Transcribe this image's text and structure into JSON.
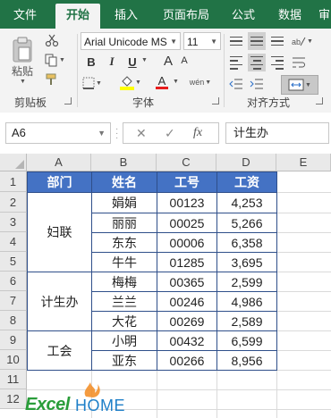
{
  "ribbon": {
    "tabs": [
      "文件",
      "开始",
      "插入",
      "页面布局",
      "公式",
      "数据",
      "审阅"
    ],
    "active_tab": "开始",
    "groups": {
      "clipboard_label": "剪贴板",
      "paste_label": "粘贴",
      "font_label": "字体",
      "alignment_label": "对齐方式"
    },
    "font_name": "Arial Unicode MS",
    "font_size": "11",
    "bold": "B",
    "italic": "I",
    "underline": "U",
    "grow_font": "A",
    "shrink_font": "A",
    "font_color": "A",
    "wen": "wén"
  },
  "formula_bar": {
    "name_box": "A6",
    "cancel": "✕",
    "enter": "✓",
    "fx": "fx",
    "content": "计生办"
  },
  "grid": {
    "column_headers": [
      "A",
      "B",
      "C",
      "D",
      "E"
    ],
    "row_headers": [
      "1",
      "2",
      "3",
      "4",
      "5",
      "6",
      "7",
      "8",
      "9",
      "10",
      "11",
      "12"
    ],
    "table": {
      "headers": [
        "部门",
        "姓名",
        "工号",
        "工资"
      ],
      "departments": [
        "妇联",
        "计生办",
        "工会"
      ],
      "rows": [
        [
          "娟娟",
          "00123",
          "4,253"
        ],
        [
          "丽丽",
          "00025",
          "5,266"
        ],
        [
          "东东",
          "00006",
          "6,358"
        ],
        [
          "牛牛",
          "01285",
          "3,695"
        ],
        [
          "梅梅",
          "00365",
          "2,599"
        ],
        [
          "兰兰",
          "00246",
          "4,986"
        ],
        [
          "大花",
          "00269",
          "2,589"
        ],
        [
          "小明",
          "00432",
          "6,599"
        ],
        [
          "亚东",
          "00266",
          "8,956"
        ]
      ]
    }
  },
  "watermark": {
    "left": "Excel",
    "right": "HOME"
  },
  "colors": {
    "ribbon_green": "#217346",
    "header_fill": "#4472c4",
    "font_color_bar": "#e81c1c",
    "highlight_bar": "#ffff00",
    "logo_green": "#2a9d3a",
    "logo_blue": "#1e7fc8"
  }
}
